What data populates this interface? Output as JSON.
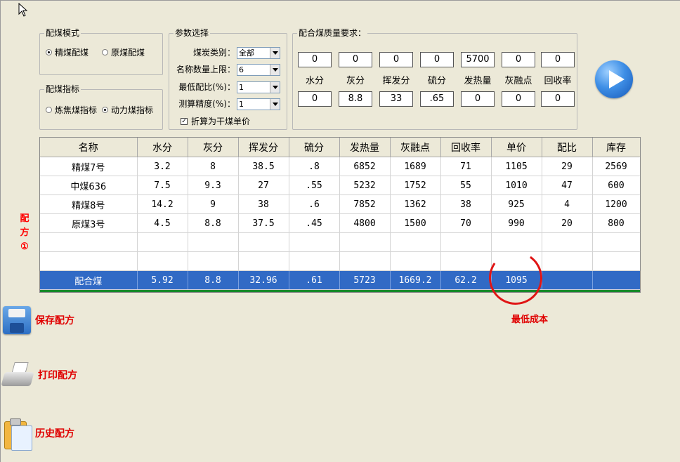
{
  "mode_group": {
    "title": "配煤模式",
    "options": [
      {
        "label": "精煤配煤",
        "selected": true
      },
      {
        "label": "原煤配煤",
        "selected": false
      }
    ]
  },
  "index_group": {
    "title": "配煤指标",
    "options": [
      {
        "label": "炼焦煤指标",
        "selected": false
      },
      {
        "label": "动力煤指标",
        "selected": true
      }
    ]
  },
  "params": {
    "title": "参数选择",
    "coal_type": {
      "label": "煤炭类别：",
      "value": "全部"
    },
    "max_names": {
      "label": "名称数量上限：",
      "value": "6"
    },
    "min_ratio": {
      "label": "最低配比(%)：",
      "value": "1"
    },
    "precision": {
      "label": "测算精度(%)：",
      "value": "1"
    },
    "convert": {
      "label": "折算为干煤单价",
      "checked": true
    }
  },
  "quality": {
    "title": "配合煤质量要求：",
    "labels": [
      "水分",
      "灰分",
      "挥发分",
      "硫分",
      "发热量",
      "灰融点",
      "回收率"
    ],
    "top": [
      "0",
      "0",
      "0",
      "0",
      "5700",
      "0",
      "0"
    ],
    "bottom": [
      "0",
      "8.8",
      "33",
      ".65",
      "0",
      "0",
      "0"
    ]
  },
  "table": {
    "headers": [
      "名称",
      "水分",
      "灰分",
      "挥发分",
      "硫分",
      "发热量",
      "灰融点",
      "回收率",
      "单价",
      "配比",
      "库存"
    ],
    "rows": [
      [
        "精煤7号",
        "3.2",
        "8",
        "38.5",
        ".8",
        "6852",
        "1689",
        "71",
        "1105",
        "29",
        "2569"
      ],
      [
        "中煤636",
        "7.5",
        "9.3",
        "27",
        ".55",
        "5232",
        "1752",
        "55",
        "1010",
        "47",
        "600"
      ],
      [
        "精煤8号",
        "14.2",
        "9",
        "38",
        ".6",
        "7852",
        "1362",
        "38",
        "925",
        "4",
        "1200"
      ],
      [
        "原煤3号",
        "4.5",
        "8.8",
        "37.5",
        ".45",
        "4800",
        "1500",
        "70",
        "990",
        "20",
        "800"
      ],
      [
        "",
        "",
        "",
        "",
        "",
        "",
        "",
        "",
        "",
        "",
        ""
      ],
      [
        "",
        "",
        "",
        "",
        "",
        "",
        "",
        "",
        "",
        "",
        ""
      ]
    ],
    "total": [
      "配合煤",
      "5.92",
      "8.8",
      "32.96",
      ".61",
      "5723",
      "1669.2",
      "62.2",
      "1095",
      "",
      ""
    ]
  },
  "annotation": {
    "vertical_label": [
      "配",
      "方",
      "①"
    ],
    "min_cost": "最低成本"
  },
  "actions": {
    "save": "保存配方",
    "print": "打印配方",
    "history": "历史配方"
  },
  "icons": {
    "run": "play-icon",
    "save": "floppy-disk-icon",
    "print": "printer-icon",
    "history": "clipboard-icon"
  }
}
